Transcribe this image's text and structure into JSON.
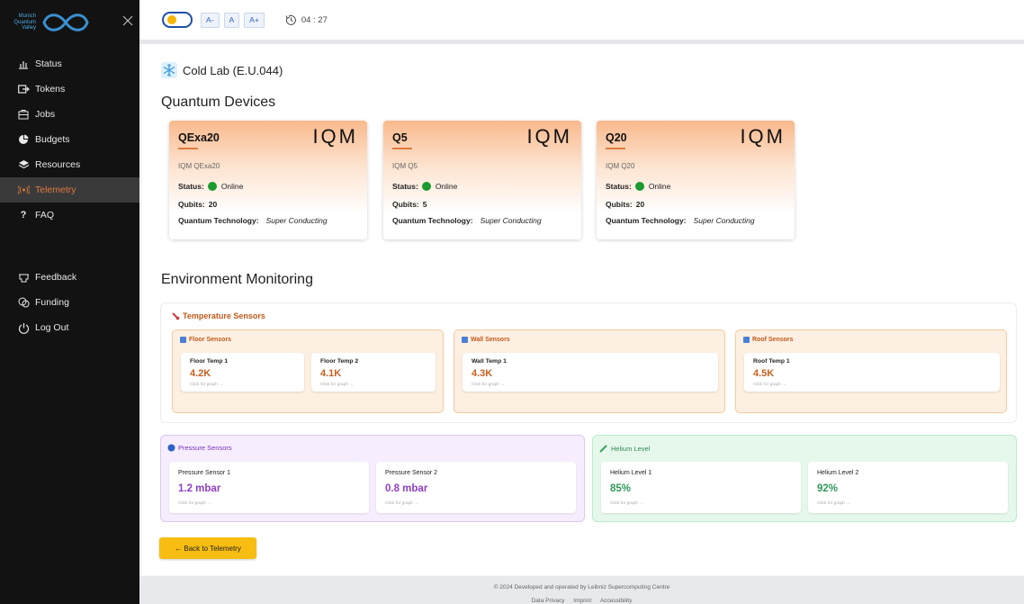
{
  "sidebar": {
    "logo": [
      "Munich",
      "Quantum",
      "Valley"
    ],
    "nav": [
      {
        "label": "Status",
        "icon": "chart-icon"
      },
      {
        "label": "Tokens",
        "icon": "token-icon"
      },
      {
        "label": "Jobs",
        "icon": "briefcase-icon"
      },
      {
        "label": "Budgets",
        "icon": "pie-icon"
      },
      {
        "label": "Resources",
        "icon": "layers-icon"
      },
      {
        "label": "Telemetry",
        "icon": "signal-icon",
        "active": true
      },
      {
        "label": "FAQ",
        "icon": "question-icon"
      }
    ],
    "nav2": [
      {
        "label": "Feedback",
        "icon": "feedback-icon"
      },
      {
        "label": "Funding",
        "icon": "funding-icon"
      },
      {
        "label": "Log Out",
        "icon": "power-icon"
      }
    ]
  },
  "topbar": {
    "font_small": "A-",
    "font_normal": "A",
    "font_large": "A+",
    "timer": "04 : 27"
  },
  "page": {
    "lab_title": "Cold Lab (E.U.044)",
    "devices_title": "Quantum Devices",
    "env_title": "Environment Monitoring"
  },
  "devices": [
    {
      "name": "QExa20",
      "brand": "IQM",
      "model": "IQM QExa20",
      "status_label": "Status:",
      "status": "Online",
      "qubits_label": "Qubits:",
      "qubits": "20",
      "tech_label": "Quantum Technology:",
      "tech": "Super Conducting"
    },
    {
      "name": "Q5",
      "brand": "IQM",
      "model": "IQM Q5",
      "status_label": "Status:",
      "status": "Online",
      "qubits_label": "Qubits:",
      "qubits": "5",
      "tech_label": "Quantum Technology:",
      "tech": "Super Conducting"
    },
    {
      "name": "Q20",
      "brand": "IQM",
      "model": "IQM Q20",
      "status_label": "Status:",
      "status": "Online",
      "qubits_label": "Qubits:",
      "qubits": "20",
      "tech_label": "Quantum Technology:",
      "tech": "Super Conducting"
    }
  ],
  "temperature": {
    "title": "Temperature Sensors",
    "groups": [
      {
        "title": "Floor Sensors",
        "sensors": [
          {
            "name": "Floor Temp 1",
            "value": "4.2K",
            "hint": "Click for graph →"
          },
          {
            "name": "Floor Temp 2",
            "value": "4.1K",
            "hint": "Click for graph →"
          }
        ]
      },
      {
        "title": "Wall Sensors",
        "sensors": [
          {
            "name": "Wall Temp 1",
            "value": "4.3K",
            "hint": "Click for graph →"
          }
        ]
      },
      {
        "title": "Roof Sensors",
        "sensors": [
          {
            "name": "Roof Temp 1",
            "value": "4.5K",
            "hint": "Click for graph →"
          }
        ]
      }
    ]
  },
  "pressure": {
    "title": "Pressure Sensors",
    "sensors": [
      {
        "name": "Pressure Sensor 1",
        "value": "1.2 mbar",
        "hint": "Click for graph →"
      },
      {
        "name": "Pressure Sensor 2",
        "value": "0.8 mbar",
        "hint": "Click for graph →"
      }
    ]
  },
  "helium": {
    "title": "Helium Level",
    "sensors": [
      {
        "name": "Helium Level 1",
        "value": "85%",
        "hint": "Click for graph →"
      },
      {
        "name": "Helium Level 2",
        "value": "92%",
        "hint": "Click for graph →"
      }
    ]
  },
  "back_button": "← Back to Telemetry",
  "footer": {
    "copyright": "© 2024 Developed and operated by Leibniz Supercomputing Centre",
    "links": [
      "Data Privacy",
      "Imprint",
      "Accessibility"
    ]
  },
  "colors": {
    "accent_orange": "#e07a3c",
    "temp_value": "#c9601f",
    "pressure_value": "#8e3fc7",
    "helium_value": "#2f9a5a",
    "online": "#1a9a2f",
    "back_button": "#f7bd12"
  }
}
